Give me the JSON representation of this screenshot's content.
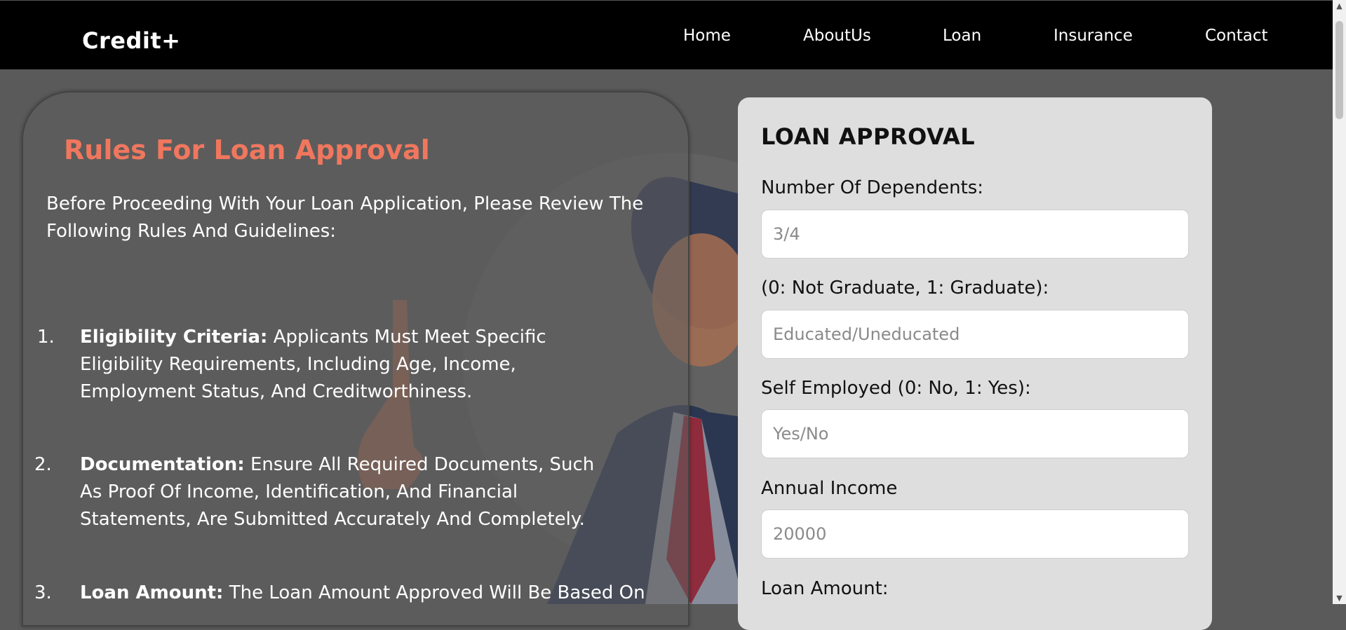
{
  "header": {
    "brand": "Credit+",
    "nav": [
      "Home",
      "AboutUs",
      "Loan",
      "Insurance",
      "Contact"
    ]
  },
  "rules": {
    "title": "Rules For Loan Approval",
    "intro": "Before Proceeding With Your Loan Application, Please Review The Following Rules And Guidelines:",
    "items": [
      {
        "num": "1.",
        "term": "Eligibility Criteria:",
        "text": " Applicants Must Meet Specific Eligibility Requirements, Including Age, Income, Employment Status, And Creditworthiness."
      },
      {
        "num": "2.",
        "term": "Documentation:",
        "text": " Ensure All Required Documents, Such As Proof Of Income, Identification, And Financial Statements, Are Submitted Accurately And Completely."
      },
      {
        "num": "3.",
        "term": "Loan Amount:",
        "text": " The Loan Amount Approved Will Be Based On"
      }
    ]
  },
  "form": {
    "title": "LOAN APPROVAL",
    "fields": [
      {
        "label": "Number Of Dependents:",
        "placeholder": "3/4"
      },
      {
        "label": "(0: Not Graduate, 1: Graduate):",
        "placeholder": "Educated/Uneducated"
      },
      {
        "label": "Self Employed (0: No, 1: Yes):",
        "placeholder": "Yes/No"
      },
      {
        "label": "Annual Income",
        "placeholder": "20000"
      },
      {
        "label": "Loan Amount:",
        "placeholder": ""
      }
    ]
  },
  "colors": {
    "accent": "#f0775e",
    "header_bg": "#000000",
    "page_bg": "#5a5a5a",
    "card_bg": "#dedede"
  },
  "icons": {
    "scroll_up": "▲",
    "scroll_down": "▼"
  }
}
